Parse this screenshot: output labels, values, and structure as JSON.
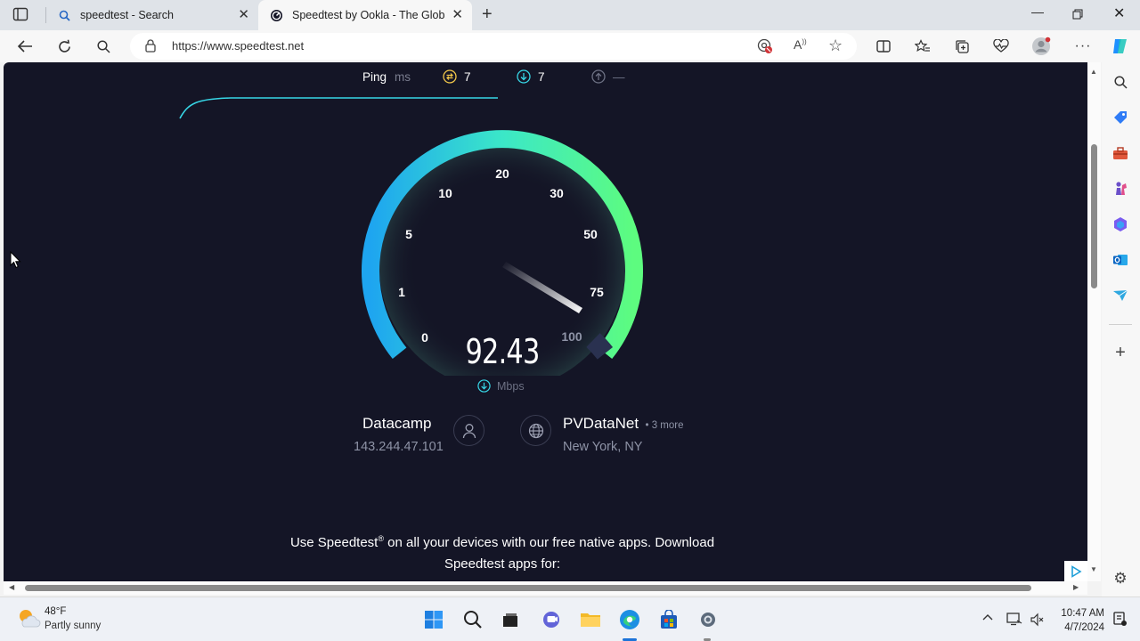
{
  "tabs": [
    {
      "title": "speedtest - Search"
    },
    {
      "title": "Speedtest by Ookla - The Global"
    }
  ],
  "address_bar": {
    "url": "https://www.speedtest.net"
  },
  "speedtest": {
    "metrics": {
      "ping_label": "Ping",
      "ping_unit": "ms",
      "idle_ping": "7",
      "download_ping": "7",
      "upload_ping": "—"
    },
    "gauge": {
      "scale_labels": [
        "0",
        "1",
        "5",
        "10",
        "20",
        "30",
        "50",
        "75",
        "100"
      ],
      "value": "92.43",
      "unit": "Mbps"
    },
    "provider": {
      "name": "Datacamp",
      "ip": "143.244.47.101"
    },
    "server": {
      "name": "PVDataNet",
      "more": "• 3 more",
      "location": "New York, NY"
    },
    "promo": {
      "line1_pre": "Use Speedtest",
      "line1_sup": "®",
      "line1_post": " on all your devices with our free native apps. Download",
      "line2": "Speedtest apps for:"
    }
  },
  "taskbar": {
    "weather_temp": "48°F",
    "weather_desc": "Partly sunny",
    "time": "10:47 AM",
    "date": "4/7/2024"
  },
  "colors": {
    "page_bg": "#141526",
    "gauge_start": "#1ea5f0",
    "gauge_end": "#5dfc7f",
    "accent_cyan": "#37d6e6"
  }
}
